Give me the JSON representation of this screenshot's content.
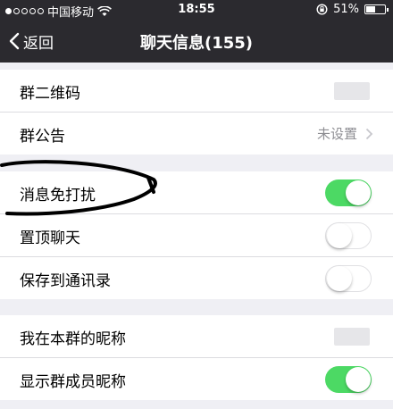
{
  "status_bar": {
    "carrier": "中国移动",
    "time": "18:55",
    "battery": "51%",
    "battery_level": 0.51
  },
  "nav": {
    "back_label": "返回",
    "title": "聊天信息(155)"
  },
  "group1": {
    "qr_label": "群二维码",
    "notice_label": "群公告",
    "notice_value": "未设置"
  },
  "group2": {
    "mute_label": "消息免打扰",
    "mute_on": true,
    "pin_label": "置顶聊天",
    "pin_on": false,
    "save_label": "保存到通讯录",
    "save_on": false
  },
  "group3": {
    "nickname_label": "我在本群的昵称",
    "show_nick_label": "显示群成员昵称",
    "show_nick_on": true
  },
  "colors": {
    "bar": "#2b2a2f",
    "switch_on": "#4cd964",
    "background": "#efeff4"
  }
}
